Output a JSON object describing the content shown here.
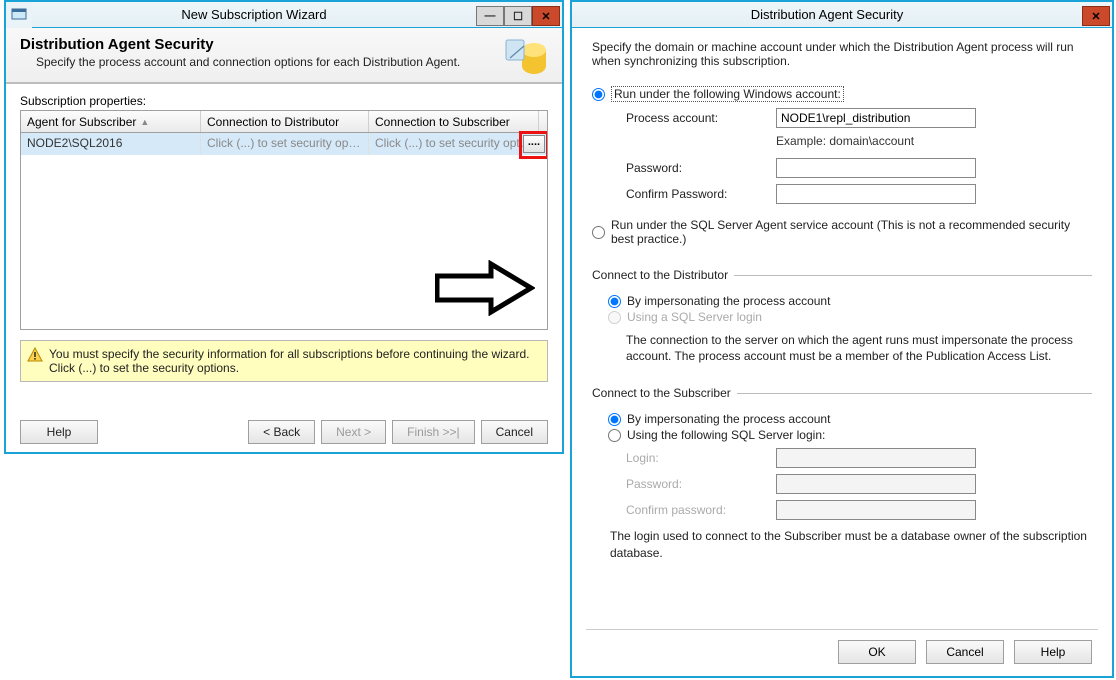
{
  "wizard": {
    "title": "New Subscription Wizard",
    "headerTitle": "Distribution Agent Security",
    "headerSub": "Specify the process account and connection options for each Distribution Agent.",
    "propsLabel": "Subscription properties:",
    "columns": {
      "a": "Agent for Subscriber",
      "b": "Connection to Distributor",
      "c": "Connection to Subscriber"
    },
    "row": {
      "agent": "NODE2\\SQL2016",
      "dist": "Click (...) to set security opti...",
      "sub": "Click (...) to set security opti..."
    },
    "ellipsis": "....",
    "info": "You must specify the security information for all subscriptions before continuing the wizard. Click (...) to set the security options.",
    "buttons": {
      "help": "Help",
      "back": "< Back",
      "next": "Next >",
      "finish": "Finish >>|",
      "cancel": "Cancel"
    }
  },
  "dlg": {
    "title": "Distribution Agent Security",
    "intro": "Specify the domain or machine account under which the Distribution Agent process will run when synchronizing this subscription.",
    "runUnderWin": "Run under the following Windows account:",
    "processAccountLabel": "Process account:",
    "processAccountValue": "NODE1\\repl_distribution",
    "example": "Example: domain\\account",
    "passwordLabel": "Password:",
    "confirmPasswordLabel": "Confirm Password:",
    "runUnderSql": "Run under the SQL Server Agent service account (This is not a recommended security best practice.)",
    "sectDist": "Connect to the Distributor",
    "distImpersonate": "By impersonating the process account",
    "distSqlLogin": "Using a SQL Server login",
    "distNote": "The connection to the server on which the agent runs must impersonate the process account. The process account must be a member of the Publication Access List.",
    "sectSub": "Connect to the Subscriber",
    "subImpersonate": "By impersonating the process account",
    "subSqlLogin": "Using the following SQL Server login:",
    "loginLabel": "Login:",
    "subPasswordLabel": "Password:",
    "subConfirmPasswordLabel": "Confirm password:",
    "subNote": "The login used to connect to the Subscriber must be a database owner of the subscription database.",
    "ok": "OK",
    "cancel": "Cancel",
    "help": "Help"
  }
}
